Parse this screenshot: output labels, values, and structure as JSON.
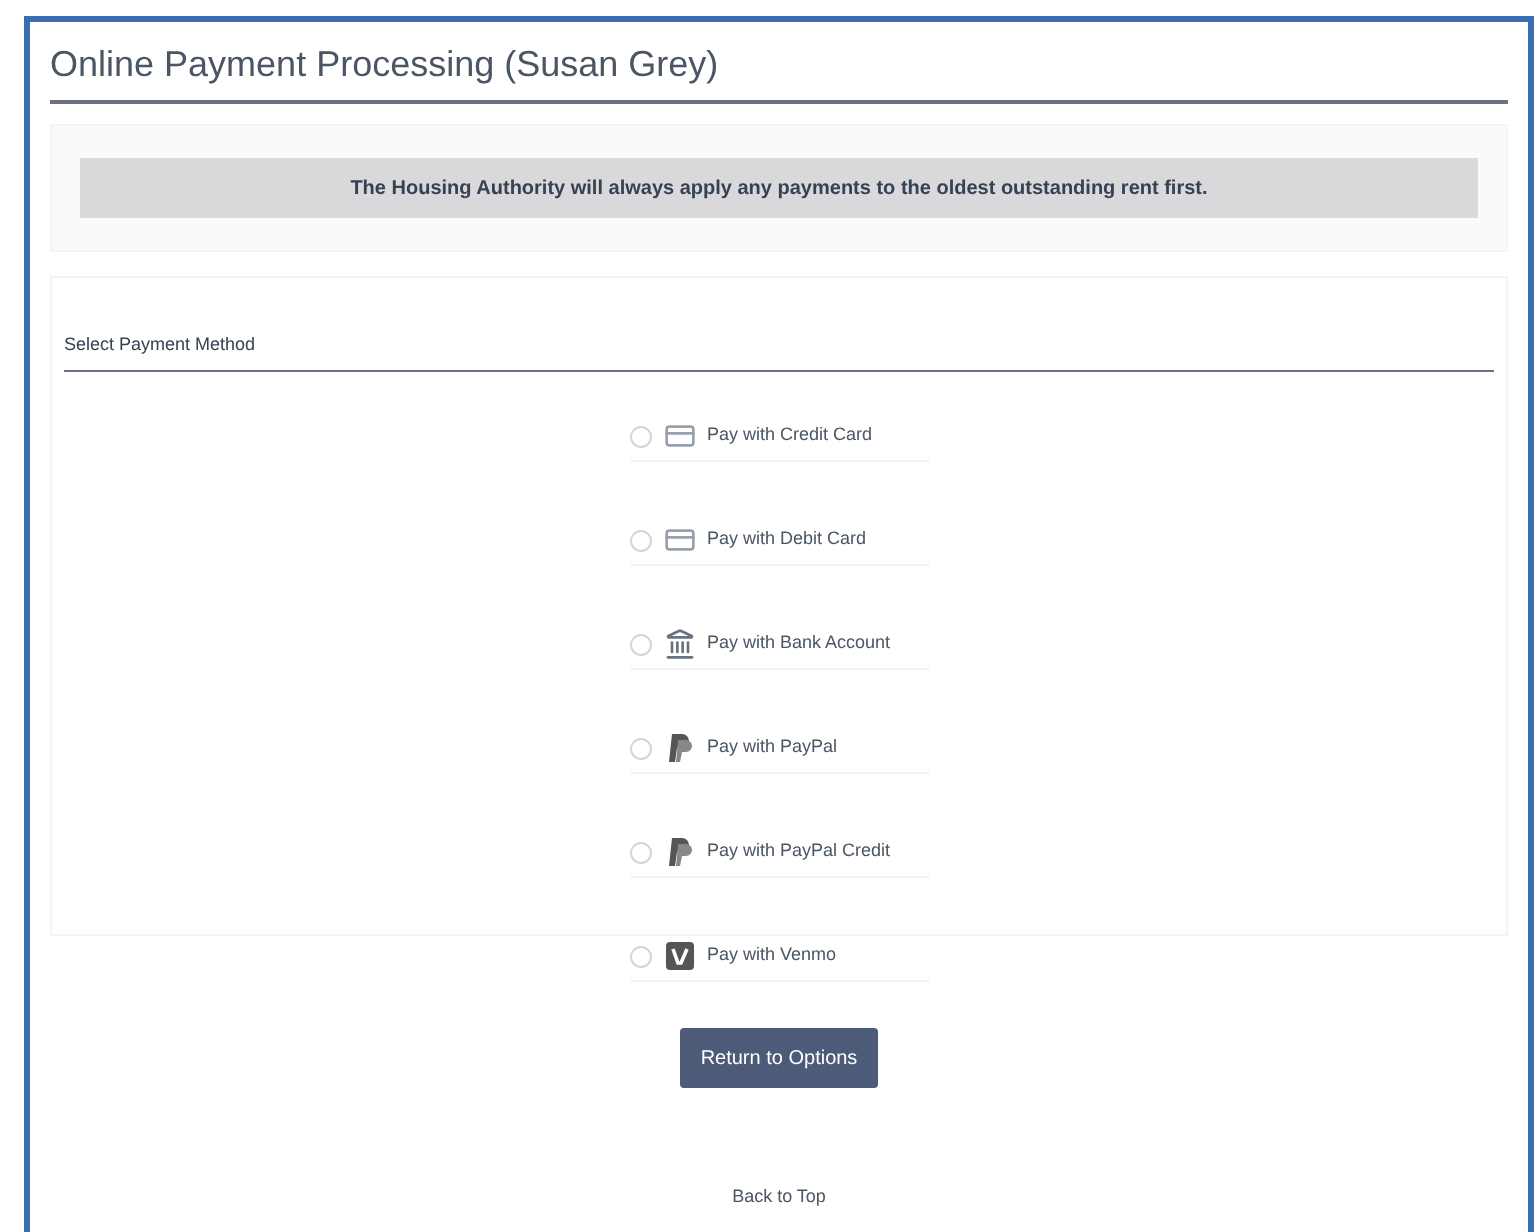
{
  "title": "Online Payment Processing (Susan Grey)",
  "notice": "The Housing Authority will always apply any payments to the oldest outstanding rent first.",
  "section_title": "Select Payment Method",
  "methods": [
    {
      "label": "Pay with Credit Card",
      "kind": "card",
      "selected": false
    },
    {
      "label": "Pay with Debit Card",
      "kind": "card",
      "selected": false
    },
    {
      "label": "Pay with Bank Account",
      "kind": "bank",
      "selected": false
    },
    {
      "label": "Pay with PayPal",
      "kind": "paypal",
      "selected": false
    },
    {
      "label": "Pay with PayPal Credit",
      "kind": "paypal",
      "selected": false
    },
    {
      "label": "Pay with Venmo",
      "kind": "venmo",
      "selected": false
    }
  ],
  "return_button": "Return to Options",
  "back_to_top": "Back to Top"
}
